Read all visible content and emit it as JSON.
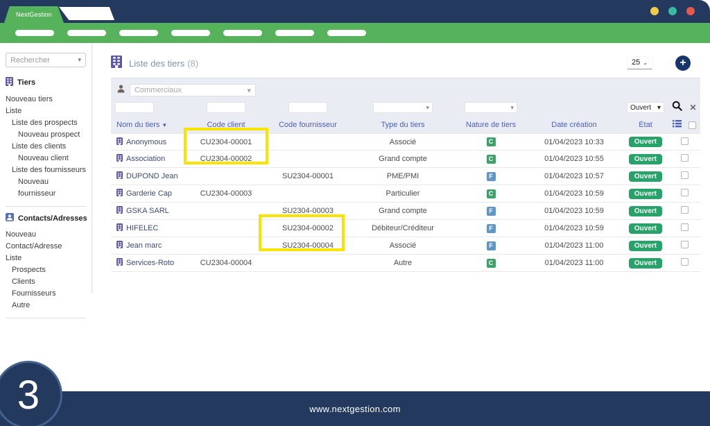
{
  "window": {
    "brand_tab": "NextGestion",
    "dot_colors": [
      "#efc94c",
      "#3ab9a0",
      "#e05a4e"
    ],
    "menu_pill_count": 7
  },
  "sidebar": {
    "search_placeholder": "Rechercher",
    "sections": [
      {
        "title": "Tiers",
        "icon": "building-icon",
        "items": [
          {
            "label": "Nouveau tiers",
            "indent": 0
          },
          {
            "label": "Liste",
            "indent": 0
          },
          {
            "label": "Liste des prospects",
            "indent": 1
          },
          {
            "label": "Nouveau prospect",
            "indent": 2
          },
          {
            "label": "Liste des clients",
            "indent": 1
          },
          {
            "label": "Nouveau client",
            "indent": 2
          },
          {
            "label": "Liste des fournisseurs",
            "indent": 1
          },
          {
            "label": "Nouveau fournisseur",
            "indent": 2
          }
        ]
      },
      {
        "title": "Contacts/Adresses",
        "icon": "contact-icon",
        "items": [
          {
            "label": "Nouveau Contact/Adresse",
            "indent": 0
          },
          {
            "label": "Liste",
            "indent": 0
          },
          {
            "label": "Prospects",
            "indent": 1
          },
          {
            "label": "Clients",
            "indent": 1
          },
          {
            "label": "Fournisseurs",
            "indent": 1
          },
          {
            "label": "Autre",
            "indent": 1
          }
        ]
      }
    ]
  },
  "header": {
    "title": "Liste des tiers",
    "count": "(8)",
    "page_size": "25",
    "add_label": "+"
  },
  "filters": {
    "commerciaux_placeholder": "Commerciaux",
    "etat_value": "Ouvert"
  },
  "table": {
    "columns": [
      "Nom du tiers",
      "Code client",
      "Code fournisseur",
      "Type du tiers",
      "Nature de tiers",
      "Date création",
      "État"
    ],
    "nature_colors": {
      "C": "#3fa06a",
      "F": "#6095c8"
    },
    "rows": [
      {
        "name": "Anonymous",
        "code_client": "CU2304-00001",
        "code_fournisseur": "",
        "type": "Associé",
        "nature": "C",
        "date": "01/04/2023 10:33",
        "etat": "Ouvert"
      },
      {
        "name": "Association",
        "code_client": "CU2304-00002",
        "code_fournisseur": "",
        "type": "Grand compte",
        "nature": "C",
        "date": "01/04/2023 10:55",
        "etat": "Ouvert"
      },
      {
        "name": "DUPOND Jean",
        "code_client": "",
        "code_fournisseur": "SU2304-00001",
        "type": "PME/PMI",
        "nature": "F",
        "date": "01/04/2023 10:57",
        "etat": "Ouvert"
      },
      {
        "name": "Garderie Cap",
        "code_client": "CU2304-00003",
        "code_fournisseur": "",
        "type": "Particulier",
        "nature": "C",
        "date": "01/04/2023 10:59",
        "etat": "Ouvert"
      },
      {
        "name": "GSKA SARL",
        "code_client": "",
        "code_fournisseur": "SU2304-00003",
        "type": "Grand compte",
        "nature": "F",
        "date": "01/04/2023 10:59",
        "etat": "Ouvert"
      },
      {
        "name": "HIFELEC",
        "code_client": "",
        "code_fournisseur": "SU2304-00002",
        "type": "Débiteur/Créditeur",
        "nature": "F",
        "date": "01/04/2023 10:59",
        "etat": "Ouvert"
      },
      {
        "name": "Jean marc",
        "code_client": "",
        "code_fournisseur": "SU2304-00004",
        "type": "Associé",
        "nature": "F",
        "date": "01/04/2023 11:00",
        "etat": "Ouvert"
      },
      {
        "name": "Services-Roto",
        "code_client": "CU2304-00004",
        "code_fournisseur": "",
        "type": "Autre",
        "nature": "C",
        "date": "01/04/2023 11:00",
        "etat": "Ouvert"
      }
    ]
  },
  "annotations": {
    "highlight_color": "#f8e400",
    "boxes": [
      "code-client-rows-1-2",
      "code-fournisseur-rows-6-7"
    ]
  },
  "footer": {
    "url": "www.nextgestion.com",
    "step_number": "3"
  }
}
